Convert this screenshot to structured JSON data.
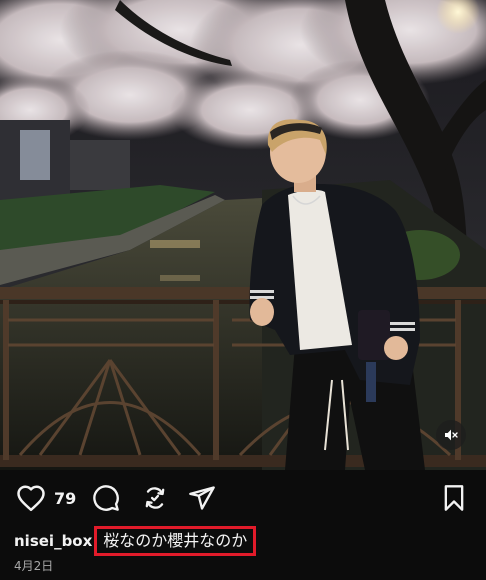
{
  "post": {
    "media": {
      "scene": "photo-night-cherry-blossom-canal",
      "mute_icon": "speaker-muted-icon"
    },
    "actions": {
      "like_icon": "heart-outline-icon",
      "like_count": "79",
      "comment_icon": "comment-bubble-icon",
      "share_icon": "repost-icon",
      "send_icon": "paper-plane-icon",
      "save_icon": "bookmark-outline-icon"
    },
    "caption": {
      "username": "nisei_box",
      "text": "桜なのか櫻井なのか",
      "highlight_color": "#e21b2a"
    },
    "date": "4月2日"
  }
}
